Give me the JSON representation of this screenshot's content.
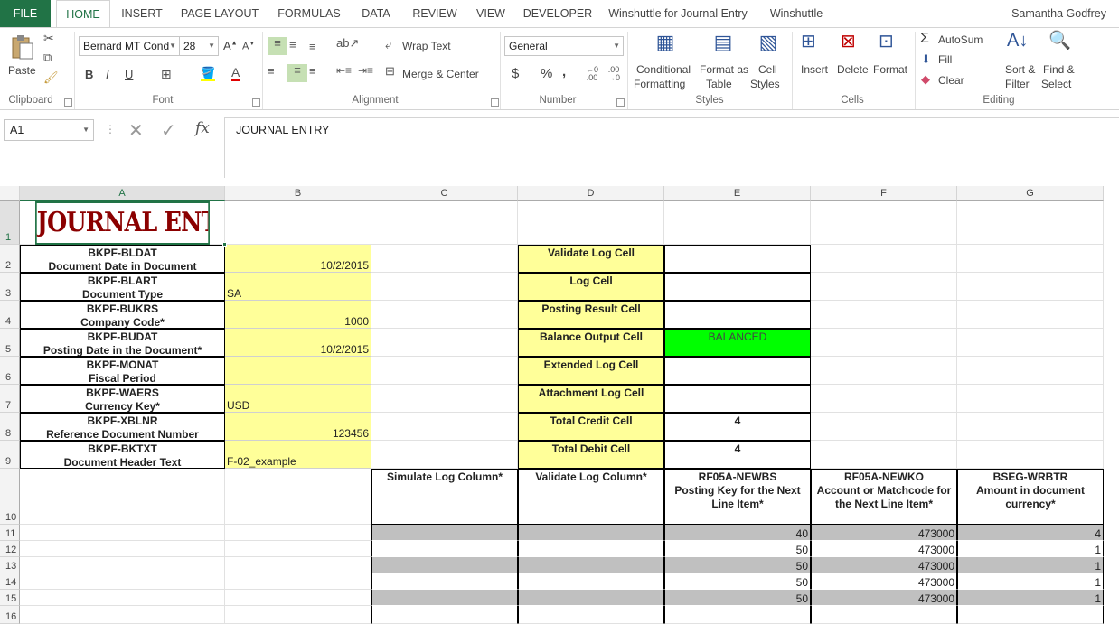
{
  "tabs": {
    "file": "FILE",
    "home": "HOME",
    "insert": "INSERT",
    "page_layout": "PAGE LAYOUT",
    "formulas": "FORMULAS",
    "data": "DATA",
    "review": "REVIEW",
    "view": "VIEW",
    "developer": "DEVELOPER",
    "winshuttle_je": "Winshuttle for Journal Entry",
    "winshuttle": "Winshuttle"
  },
  "user": "Samantha Godfrey",
  "ribbon": {
    "clipboard": {
      "paste": "Paste",
      "label": "Clipboard"
    },
    "font": {
      "name": "Bernard MT Cond",
      "size": "28",
      "bold": "B",
      "italic": "I",
      "underline": "U",
      "label": "Font"
    },
    "alignment": {
      "wrap_text": "Wrap Text",
      "merge_center": "Merge & Center",
      "label": "Alignment"
    },
    "number": {
      "format": "General",
      "currency": "$",
      "percent": "%",
      "comma": ",",
      "label": "Number"
    },
    "styles": {
      "conditional": "Conditional",
      "formatting": "Formatting",
      "format_as": "Format as",
      "table": "Table",
      "cell": "Cell",
      "styles": "Styles",
      "label": "Styles"
    },
    "cells": {
      "insert": "Insert",
      "delete": "Delete",
      "format": "Format",
      "label": "Cells"
    },
    "editing": {
      "autosum": "AutoSum",
      "fill": "Fill",
      "clear": "Clear",
      "sort": "Sort &",
      "filter": "Filter",
      "find": "Find &",
      "select": "Select",
      "label": "Editing"
    }
  },
  "formula_bar": {
    "name_box": "A1",
    "fx": "fx",
    "value": "JOURNAL ENTRY"
  },
  "columns": [
    "A",
    "B",
    "C",
    "D",
    "E",
    "F",
    "G"
  ],
  "rows": [
    "1",
    "2",
    "3",
    "4",
    "5",
    "6",
    "7",
    "8",
    "9",
    "10",
    "11",
    "12",
    "13",
    "14",
    "15",
    "16"
  ],
  "title": "JOURNAL ENTRY",
  "header_fields": [
    {
      "code": "BKPF-BLDAT",
      "desc": "Document Date in Document",
      "value": "10/2/2015",
      "align": "right"
    },
    {
      "code": "BKPF-BLART",
      "desc": "Document Type",
      "value": "SA",
      "align": "left"
    },
    {
      "code": "BKPF-BUKRS",
      "desc": "Company Code*",
      "value": "1000",
      "align": "right"
    },
    {
      "code": "BKPF-BUDAT",
      "desc": "Posting Date in the Document*",
      "value": "10/2/2015",
      "align": "right"
    },
    {
      "code": "BKPF-MONAT",
      "desc": "Fiscal Period",
      "value": "",
      "align": "right"
    },
    {
      "code": "BKPF-WAERS",
      "desc": "Currency Key*",
      "value": "USD",
      "align": "left"
    },
    {
      "code": "BKPF-XBLNR",
      "desc": "Reference Document Number",
      "value": "123456",
      "align": "right"
    },
    {
      "code": "BKPF-BKTXT",
      "desc": "Document Header Text",
      "value": "F-02_example",
      "align": "left"
    }
  ],
  "status_cells": [
    {
      "label": "Validate Log Cell",
      "value": ""
    },
    {
      "label": "Log Cell",
      "value": ""
    },
    {
      "label": "Posting Result Cell",
      "value": ""
    },
    {
      "label": "Balance Output Cell",
      "value": "BALANCED"
    },
    {
      "label": "Extended Log Cell",
      "value": ""
    },
    {
      "label": "Attachment Log Cell",
      "value": ""
    },
    {
      "label": "Total Credit Cell",
      "value": "4"
    },
    {
      "label": "Total Debit Cell",
      "value": "4"
    }
  ],
  "line_headers": {
    "c": "Simulate Log Column*",
    "d": "Validate Log Column*",
    "e1": "RF05A-NEWBS",
    "e2": "Posting Key for the Next",
    "e3": "Line Item*",
    "f1": "RF05A-NEWKO",
    "f2": "Account or Matchcode for",
    "f3": "the Next Line Item*",
    "g1": "BSEG-WRBTR",
    "g2": "Amount in document",
    "g3": "currency*"
  },
  "line_items": [
    {
      "posting_key": "40",
      "account": "473000",
      "amount": "4"
    },
    {
      "posting_key": "50",
      "account": "473000",
      "amount": "1"
    },
    {
      "posting_key": "50",
      "account": "473000",
      "amount": "1"
    },
    {
      "posting_key": "50",
      "account": "473000",
      "amount": "1"
    },
    {
      "posting_key": "50",
      "account": "473000",
      "amount": "1"
    }
  ],
  "colors": {
    "excel_green": "#217346",
    "yellow": "#ffff99",
    "balanced": "#00ff00",
    "title_red": "#8b0000",
    "row_gray": "#c0c0c0"
  }
}
